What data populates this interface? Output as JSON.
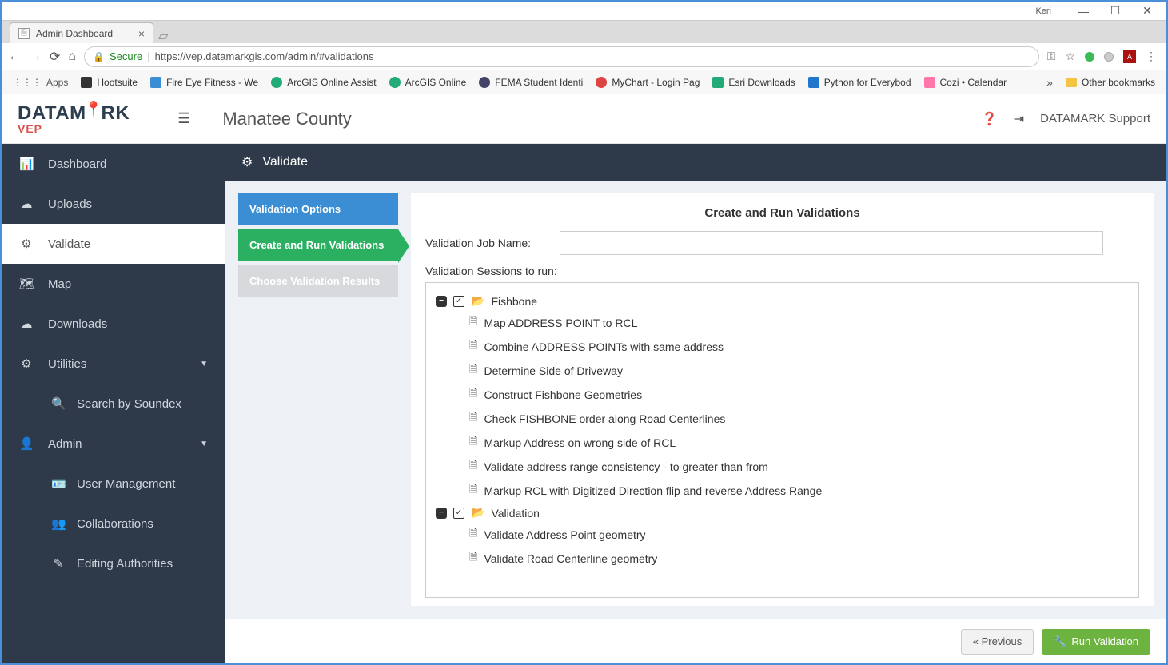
{
  "window": {
    "user": "Keri"
  },
  "browser": {
    "tab_title": "Admin Dashboard",
    "secure_label": "Secure",
    "url_display": "https://vep.datamarkgis.com/admin/#validations",
    "bookmarks": [
      {
        "label": "Apps"
      },
      {
        "label": "Hootsuite"
      },
      {
        "label": "Fire Eye Fitness - We"
      },
      {
        "label": "ArcGIS Online Assist"
      },
      {
        "label": "ArcGIS Online"
      },
      {
        "label": "FEMA Student Identi"
      },
      {
        "label": "MyChart - Login Pag"
      },
      {
        "label": "Esri Downloads"
      },
      {
        "label": "Python for Everybod"
      },
      {
        "label": "Cozi • Calendar"
      }
    ],
    "other_bookmarks": "Other bookmarks"
  },
  "header": {
    "logo_main": "DATAM",
    "logo_main2": "RK",
    "logo_sub": "VEP",
    "county": "Manatee County",
    "user_label": "DATAMARK Support"
  },
  "sidebar": {
    "items": [
      {
        "label": "Dashboard"
      },
      {
        "label": "Uploads"
      },
      {
        "label": "Validate"
      },
      {
        "label": "Map"
      },
      {
        "label": "Downloads"
      },
      {
        "label": "Utilities"
      },
      {
        "label": "Search by Soundex"
      },
      {
        "label": "Admin"
      },
      {
        "label": "User Management"
      },
      {
        "label": "Collaborations"
      },
      {
        "label": "Editing Authorities"
      }
    ]
  },
  "content": {
    "header": "Validate",
    "steps": [
      {
        "label": "Validation Options"
      },
      {
        "label": "Create and Run Validations"
      },
      {
        "label": "Choose Validation Results"
      }
    ],
    "panel_title": "Create and Run Validations",
    "job_name_label": "Validation Job Name:",
    "job_name_value": "",
    "sessions_label": "Validation Sessions to run:",
    "tree": [
      {
        "type": "group",
        "label": "Fishbone"
      },
      {
        "type": "child",
        "label": "Map ADDRESS POINT to RCL"
      },
      {
        "type": "child",
        "label": "Combine ADDRESS POINTs with same address"
      },
      {
        "type": "child",
        "label": "Determine Side of Driveway"
      },
      {
        "type": "child",
        "label": "Construct Fishbone Geometries"
      },
      {
        "type": "child",
        "label": "Check FISHBONE order along Road Centerlines"
      },
      {
        "type": "child",
        "label": "Markup Address on wrong side of RCL"
      },
      {
        "type": "child",
        "label": "Validate address range consistency - to greater than from"
      },
      {
        "type": "child",
        "label": "Markup RCL with Digitized Direction flip and reverse Address Range"
      },
      {
        "type": "group",
        "label": "Validation"
      },
      {
        "type": "child",
        "label": "Validate Address Point geometry"
      },
      {
        "type": "child",
        "label": "Validate Road Centerline geometry"
      }
    ],
    "prev_button": "« Previous",
    "run_button": "Run Validation"
  }
}
